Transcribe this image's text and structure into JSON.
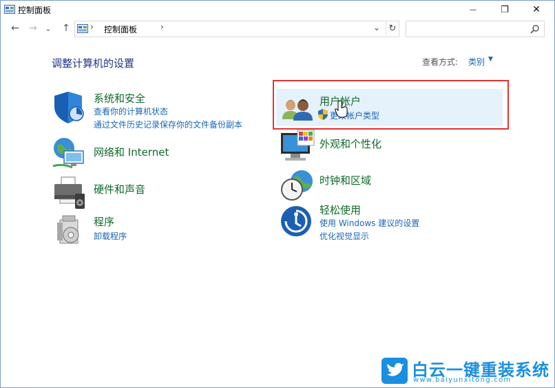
{
  "window": {
    "title": "控制面板",
    "minimize_label": "—",
    "maximize_label": "❐",
    "close_label": "✕"
  },
  "nav": {
    "back": "←",
    "forward": "→",
    "recent": "⌄",
    "up": "↑"
  },
  "address": {
    "separator": "›",
    "crumb": "控制面板",
    "dropdown": "⌄",
    "refresh": "↻"
  },
  "search": {
    "placeholder": "",
    "value": ""
  },
  "content": {
    "heading": "调整计算机的设置",
    "view_by_label": "查看方式:",
    "view_by_value": "类别",
    "view_by_arrow": "▼"
  },
  "categories": [
    {
      "title": "系统和安全",
      "links": [
        "查看你的计算机状态",
        "通过文件历史记录保存你的文件备份副本"
      ],
      "icon": "shield-icon"
    },
    {
      "title": "网络和 Internet",
      "links": [],
      "icon": "network-icon"
    },
    {
      "title": "硬件和声音",
      "links": [],
      "icon": "printer-icon"
    },
    {
      "title": "程序",
      "links": [
        "卸载程序"
      ],
      "icon": "programs-icon"
    },
    {
      "title": "用户帐户",
      "links": [
        "更改帐户类型"
      ],
      "icon": "users-icon"
    },
    {
      "title": "外观和个性化",
      "links": [],
      "icon": "monitor-icon"
    },
    {
      "title": "时钟和区域",
      "links": [],
      "icon": "clock-globe-icon"
    },
    {
      "title": "轻松使用",
      "links": [
        "使用 Windows 建议的设置",
        "优化视觉显示"
      ],
      "icon": "ease-of-access-icon"
    }
  ],
  "watermark": {
    "title": "白云一键重装系统",
    "url": "www.baiyunxitong.com"
  },
  "colors": {
    "category_title": "#0f6a2a",
    "link": "#1a66b8",
    "highlight": "#e5f1fb",
    "annotation_box": "#e23232",
    "watermark": "#1a8fe0"
  }
}
